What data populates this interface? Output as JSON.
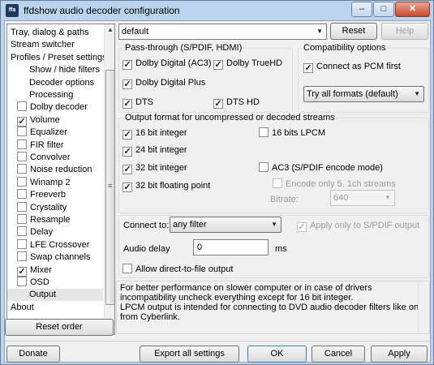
{
  "window": {
    "title": "ffdshow audio decoder configuration",
    "app_icon_text": "ffa"
  },
  "titlebar_buttons": {
    "minimize": "–",
    "maximize": "□",
    "close": "✕"
  },
  "tree": {
    "items": [
      {
        "label": "Tray, dialog & paths",
        "indent": 0,
        "checkbox": false
      },
      {
        "label": "Stream switcher",
        "indent": 0,
        "checkbox": false
      },
      {
        "label": "Profiles / Preset settings",
        "indent": 0,
        "checkbox": false
      },
      {
        "label": "Show / hide filters",
        "indent": 1,
        "checkbox": false
      },
      {
        "label": "Decoder options",
        "indent": 1,
        "checkbox": false
      },
      {
        "label": "Processing",
        "indent": 1,
        "checkbox": false
      },
      {
        "label": "Dolby decoder",
        "indent": 1,
        "checkbox": true,
        "checked": false
      },
      {
        "label": "Volume",
        "indent": 1,
        "checkbox": true,
        "checked": true
      },
      {
        "label": "Equalizer",
        "indent": 1,
        "checkbox": true,
        "checked": false
      },
      {
        "label": "FIR filter",
        "indent": 1,
        "checkbox": true,
        "checked": false
      },
      {
        "label": "Convolver",
        "indent": 1,
        "checkbox": true,
        "checked": false
      },
      {
        "label": "Noise reduction",
        "indent": 1,
        "checkbox": true,
        "checked": false
      },
      {
        "label": "Winamp 2",
        "indent": 1,
        "checkbox": true,
        "checked": false
      },
      {
        "label": "Freeverb",
        "indent": 1,
        "checkbox": true,
        "checked": false
      },
      {
        "label": "Crystality",
        "indent": 1,
        "checkbox": true,
        "checked": false
      },
      {
        "label": "Resample",
        "indent": 1,
        "checkbox": true,
        "checked": false
      },
      {
        "label": "Delay",
        "indent": 1,
        "checkbox": true,
        "checked": false
      },
      {
        "label": "LFE Crossover",
        "indent": 1,
        "checkbox": true,
        "checked": false
      },
      {
        "label": "Swap channels",
        "indent": 1,
        "checkbox": true,
        "checked": false
      },
      {
        "label": "Mixer",
        "indent": 1,
        "checkbox": true,
        "checked": true
      },
      {
        "label": "OSD",
        "indent": 1,
        "checkbox": true,
        "checked": false
      },
      {
        "label": "Output",
        "indent": 1,
        "checkbox": false,
        "selected": true
      },
      {
        "label": "About",
        "indent": 0,
        "checkbox": false
      }
    ],
    "scroll_up": "▲",
    "scroll_down": "▼",
    "grip": "≡"
  },
  "preset": {
    "value": "default",
    "arrow": "▼"
  },
  "buttons": {
    "reset": "Reset",
    "help": "Help",
    "reset_order": "Reset order",
    "donate": "Donate",
    "export": "Export all settings",
    "ok": "OK",
    "cancel": "Cancel",
    "apply": "Apply"
  },
  "passthrough": {
    "title": "Pass-through (S/PDIF, HDMI)",
    "ac3": "Dolby Digital (AC3)",
    "truehd": "Dolby TrueHD",
    "ddplus": "Dolby Digital Plus",
    "dts": "DTS",
    "dtshd": "DTS HD"
  },
  "compat": {
    "title": "Compatibility options",
    "pcm_first": "Connect as PCM first",
    "formats": "Try all formats (default)",
    "arrow": "▼"
  },
  "output_format": {
    "title": "Output format for uncompressed or decoded streams",
    "b16": "16 bit integer",
    "b24": "24 bit integer",
    "b32": "32 bit integer",
    "f32": "32 bit floating point",
    "lpcm16": "16 bits LPCM",
    "ac3enc": "AC3 (S/PDIF encode mode)",
    "encode_51": "Encode only 5. 1ch streams",
    "bitrate_label": "Bitrate:",
    "bitrate": "640",
    "arrow": "▼"
  },
  "connect": {
    "label": "Connect to:",
    "value": "any filter",
    "arrow": "▼",
    "spdif_only": "Apply only to S/PDIF output",
    "delay_label": "Audio delay",
    "delay_value": "0",
    "delay_unit": "ms",
    "direct_file": "Allow direct-to-file output"
  },
  "info": {
    "line1": "For better performance on slower computer or in case of drivers",
    "line2": "incompatibility uncheck everything except for 16 bit integer.",
    "line3": "LPCM output is intended for connecting to DVD audio decoder filters like one",
    "line4": "from Cyberlink."
  },
  "checkmark": "✓"
}
